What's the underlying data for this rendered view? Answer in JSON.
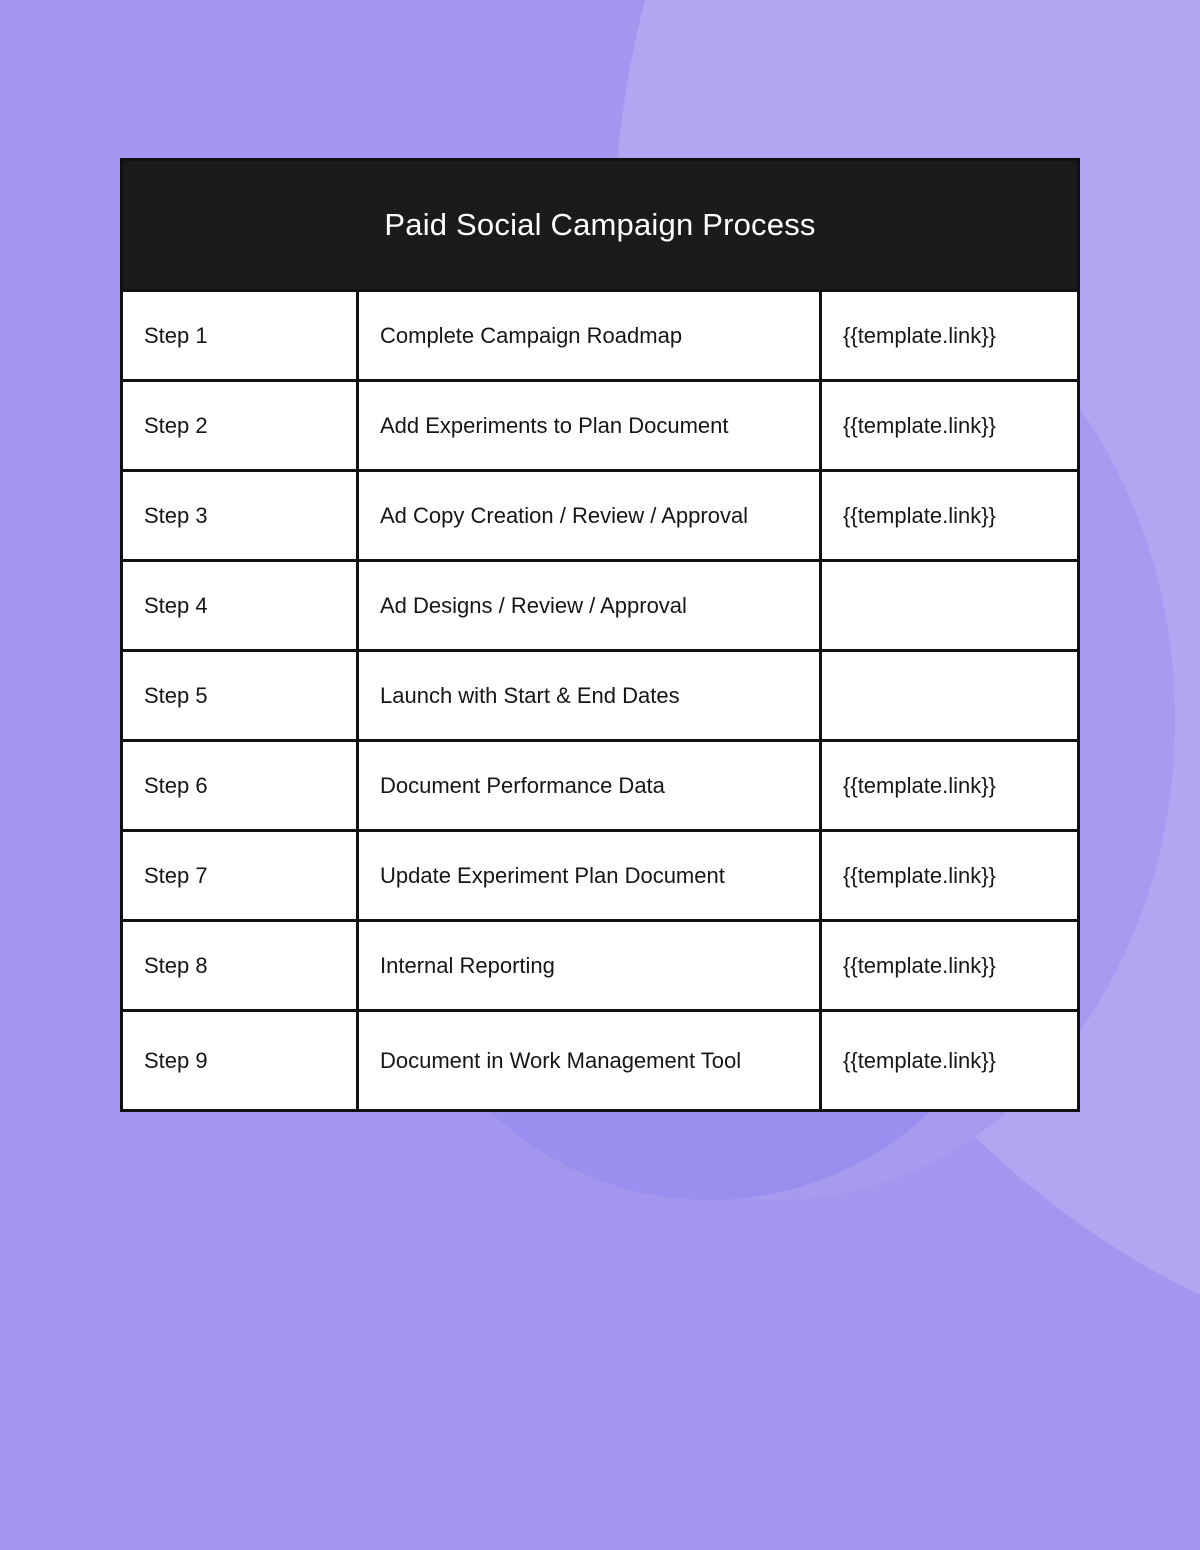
{
  "colors": {
    "background": "#a296ef",
    "background_light": "#b0a6f2",
    "header_bg": "#1b1b1b",
    "header_text": "#ffffff",
    "cell_bg": "#ffffff",
    "border": "#111111"
  },
  "table": {
    "title": "Paid Social Campaign Process",
    "rows": [
      {
        "step": "Step 1",
        "task": "Complete Campaign Roadmap",
        "link": "{{template.link}}"
      },
      {
        "step": "Step 2",
        "task": "Add Experiments to Plan Document",
        "link": "{{template.link}}"
      },
      {
        "step": "Step 3",
        "task": "Ad Copy Creation / Review / Approval",
        "link": "{{template.link}}"
      },
      {
        "step": "Step 4",
        "task": "Ad Designs / Review / Approval",
        "link": ""
      },
      {
        "step": "Step 5",
        "task": "Launch with Start & End Dates",
        "link": ""
      },
      {
        "step": "Step 6",
        "task": "Document Performance Data",
        "link": "{{template.link}}"
      },
      {
        "step": "Step 7",
        "task": "Update Experiment Plan Document",
        "link": "{{template.link}}"
      },
      {
        "step": "Step 8",
        "task": "Internal Reporting",
        "link": "{{template.link}}"
      },
      {
        "step": "Step 9",
        "task": "Document in Work Management Tool",
        "link": "{{template.link}}"
      }
    ]
  }
}
